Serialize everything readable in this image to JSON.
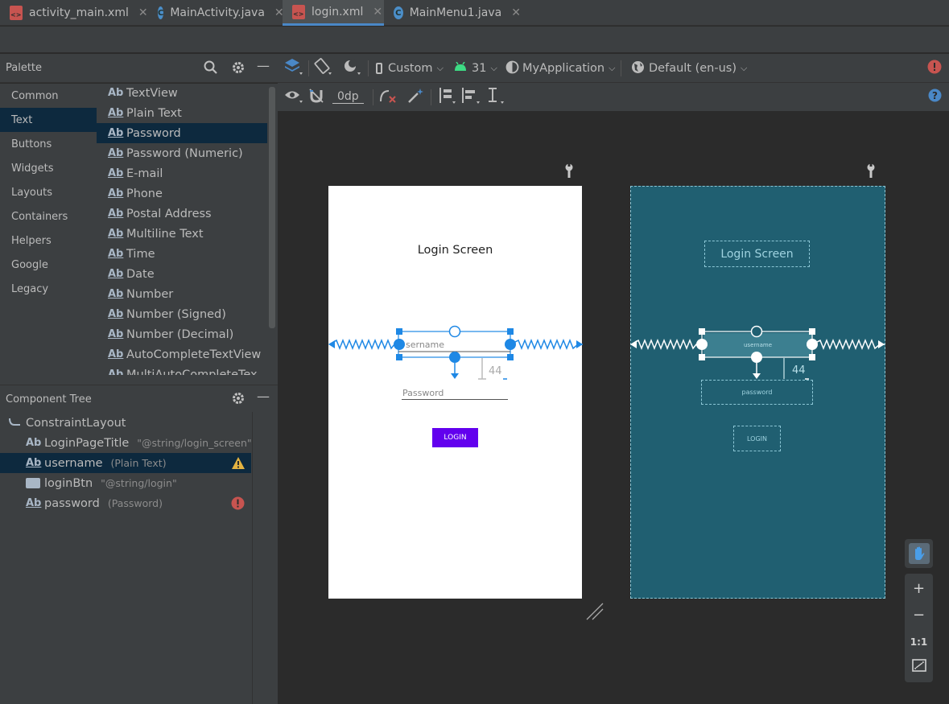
{
  "tabs": [
    {
      "label": "activity_main.xml",
      "kind": "xml"
    },
    {
      "label": "MainActivity.java",
      "kind": "java"
    },
    {
      "label": "login.xml",
      "kind": "xml"
    },
    {
      "label": "MainMenu1.java",
      "kind": "java"
    }
  ],
  "palette": {
    "title": "Palette",
    "categories": [
      "Common",
      "Text",
      "Buttons",
      "Widgets",
      "Layouts",
      "Containers",
      "Helpers",
      "Google",
      "Legacy"
    ],
    "selected_category": "Text",
    "items": [
      "TextView",
      "Plain Text",
      "Password",
      "Password (Numeric)",
      "E-mail",
      "Phone",
      "Postal Address",
      "Multiline Text",
      "Time",
      "Date",
      "Number",
      "Number (Signed)",
      "Number (Decimal)",
      "AutoCompleteTextView",
      "MultiAutoCompleteTex"
    ],
    "selected_item": "Password",
    "item_icon": "Ab"
  },
  "component_tree": {
    "title": "Component Tree",
    "rows": [
      {
        "label": "ConstraintLayout",
        "sub": ""
      },
      {
        "label": "LoginPageTitle",
        "sub": "\"@string/login_screen\""
      },
      {
        "label": "username",
        "sub": "(Plain Text)"
      },
      {
        "label": "loginBtn",
        "sub": "\"@string/login\""
      },
      {
        "label": "password",
        "sub": "(Password)"
      }
    ]
  },
  "toolbar": {
    "device": "Custom",
    "api": "31",
    "theme": "MyApplication",
    "locale": "Default (en-us)",
    "margin": "0dp"
  },
  "design": {
    "title": "Login Screen",
    "username_hint": "sername",
    "password_hint": "Password",
    "login_label": "LOGIN",
    "margin_value": "44"
  },
  "blueprint": {
    "title": "Login Screen",
    "username_label": "username",
    "password_label": "password",
    "login_label": "LOGIN",
    "margin_value": "44"
  },
  "zoom": {
    "one_to_one": "1:1"
  },
  "colors": {
    "accent": "#4a88c7",
    "login_button": "#6200ee",
    "blueprint_bg": "#205f71",
    "error": "#c75450",
    "warning": "#e3b341"
  }
}
